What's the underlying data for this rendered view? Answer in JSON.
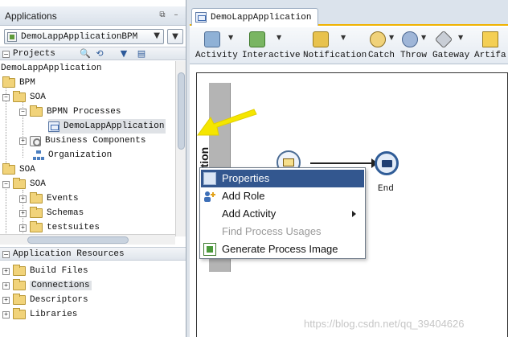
{
  "applications_panel": {
    "title": "Applications",
    "minimize_glyph": "⧉",
    "close_glyph": "–",
    "selected_app": "DemoLappApplicationBPM",
    "dropdown_glyph": "▼",
    "menu_glyph": "▼"
  },
  "projects_section": {
    "label": "Projects",
    "toggle_glyph": "−",
    "tool_icons": [
      "search-icon",
      "sync-icon",
      "filter-icon",
      "layout-icon"
    ],
    "tool_glyphs": [
      "🔍",
      "⟲",
      "▼",
      "▤"
    ]
  },
  "project_tree": [
    {
      "label": "DemoLappApplication",
      "icon": "none",
      "exp": ""
    },
    {
      "label": "BPM",
      "icon": "folder",
      "exp": ""
    },
    {
      "label": "SOA",
      "icon": "folder",
      "exp": "−"
    },
    {
      "label": "BPMN Processes",
      "icon": "folder",
      "exp": "−"
    },
    {
      "label": "DemoLappApplication",
      "icon": "process",
      "exp": "",
      "selected": true
    },
    {
      "label": "Business Components",
      "icon": "components",
      "exp": "+"
    },
    {
      "label": "Organization",
      "icon": "organization",
      "exp": ""
    },
    {
      "label": "SOA",
      "icon": "folder",
      "exp": ""
    },
    {
      "label": "SOA",
      "icon": "folder",
      "exp": "−"
    },
    {
      "label": "Events",
      "icon": "folder",
      "exp": "+"
    },
    {
      "label": "Schemas",
      "icon": "folder",
      "exp": "+"
    },
    {
      "label": "testsuites",
      "icon": "folder",
      "exp": "+"
    }
  ],
  "resources_section": {
    "label": "Application Resources",
    "toggle_glyph": "−"
  },
  "resource_tree": [
    {
      "label": "Build Files",
      "icon": "folder",
      "exp": "+"
    },
    {
      "label": "Connections",
      "icon": "folder",
      "exp": "+",
      "selected": true
    },
    {
      "label": "Descriptors",
      "icon": "folder",
      "exp": "+"
    },
    {
      "label": "Libraries",
      "icon": "folder",
      "exp": "+"
    }
  ],
  "editor": {
    "tab_label": "DemoLappApplication",
    "palette": [
      {
        "label": "Activity",
        "icon": "gear-icon",
        "color": "#8fb1d6"
      },
      {
        "label": "Interactive",
        "icon": "user-task-icon",
        "color": "#79b562"
      },
      {
        "label": "Notification",
        "icon": "envelope-icon",
        "color": "#e8c24d"
      },
      {
        "label": "Catch",
        "icon": "catch-event-icon",
        "color": "#f0d27a"
      },
      {
        "label": "Throw",
        "icon": "throw-event-icon",
        "color": "#9fb6d8"
      },
      {
        "label": "Gateway",
        "icon": "gateway-icon",
        "color": "#c9ced6"
      },
      {
        "label": "Artifa",
        "icon": "artifact-icon",
        "color": "#f4cf54"
      }
    ],
    "dropdown_glyph": "▼"
  },
  "diagram": {
    "lane_label": "Application",
    "end_label": "End"
  },
  "context_menu": {
    "items": [
      {
        "label": "Properties",
        "icon": "properties-icon",
        "highlighted": true
      },
      {
        "label": "Add Role",
        "icon": "add-role-icon"
      },
      {
        "label": "Add Activity",
        "icon": "none",
        "submenu": true
      },
      {
        "label": "Find Process Usages",
        "icon": "none",
        "disabled": true
      },
      {
        "label": "Generate Process Image",
        "icon": "image-icon"
      }
    ]
  },
  "watermark": "https://blog.csdn.net/qq_39404626",
  "colors": {
    "accent_tab_border": "#f0b200",
    "menu_highlight": "#33578f",
    "arrow_annotation": "#f5e600"
  }
}
